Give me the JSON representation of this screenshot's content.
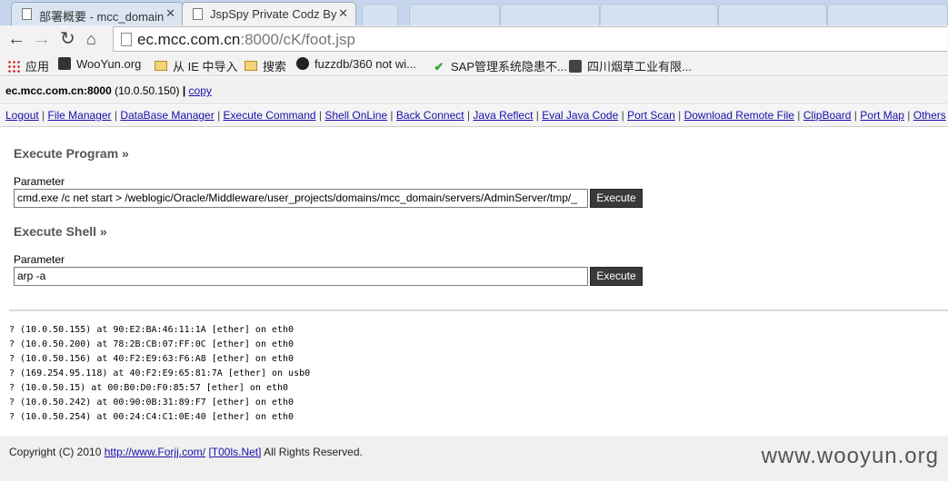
{
  "browser": {
    "tabs": [
      {
        "title": "部署概要 - mcc_domain",
        "active": false
      },
      {
        "title": "JspSpy Private Codz By",
        "active": true
      }
    ],
    "url": {
      "host": "ec.mcc.com.cn",
      "rest": ":8000/cK/foot.jsp"
    },
    "bookmarks": [
      {
        "label": "应用",
        "icon": "apps-grid-icon"
      },
      {
        "label": "WooYun.org",
        "icon": "site-favicon"
      },
      {
        "label": "从 IE 中导入",
        "icon": "folder-icon"
      },
      {
        "label": "搜索",
        "icon": "folder-icon"
      },
      {
        "label": "fuzzdb/360 not wi...",
        "icon": "github-icon"
      },
      {
        "label": "SAP管理系统隐患不...",
        "icon": "checkmark-icon"
      },
      {
        "label": "四川烟草工业有限...",
        "icon": "site-favicon"
      }
    ]
  },
  "host_info": {
    "host": "ec.mcc.com.cn:8000",
    "ip": "(10.0.50.150)",
    "separator": "|",
    "copy_label": "copy"
  },
  "nav": {
    "links": [
      "Logout",
      "File Manager",
      "DataBase Manager",
      "Execute Command",
      "Shell OnLine",
      "Back Connect",
      "Java Reflect",
      "Eval Java Code",
      "Port Scan",
      "Download Remote File",
      "ClipBoard",
      "Port Map",
      "Others"
    ],
    "separator": " | "
  },
  "execute_program": {
    "title": "Execute Program »",
    "param_label": "Parameter",
    "value": "cmd.exe /c net start > /weblogic/Oracle/Middleware/user_projects/domains/mcc_domain/servers/AdminServer/tmp/_",
    "button": "Execute"
  },
  "execute_shell": {
    "title": "Execute Shell »",
    "param_label": "Parameter",
    "value": "arp -a",
    "button": "Execute"
  },
  "output_lines": [
    "? (10.0.50.155) at 90:E2:BA:46:11:1A [ether] on eth0",
    "? (10.0.50.200) at 78:2B:CB:07:FF:0C [ether] on eth0",
    "? (10.0.50.156) at 40:F2:E9:63:F6:A8 [ether] on eth0",
    "? (169.254.95.118) at 40:F2:E9:65:81:7A [ether] on usb0",
    "? (10.0.50.15) at 00:B0:D0:F0:85:57 [ether] on eth0",
    "? (10.0.50.242) at 00:90:0B:31:89:F7 [ether] on eth0",
    "? (10.0.50.254) at 00:24:C4:C1:0E:40 [ether] on eth0"
  ],
  "footer": {
    "copyright": "Copyright (C) 2010",
    "link1": "http://www.Forjj.com/",
    "link2": "[T00ls.Net]",
    "rights": "All Rights Reserved.",
    "watermark": "www.wooyun.org"
  }
}
